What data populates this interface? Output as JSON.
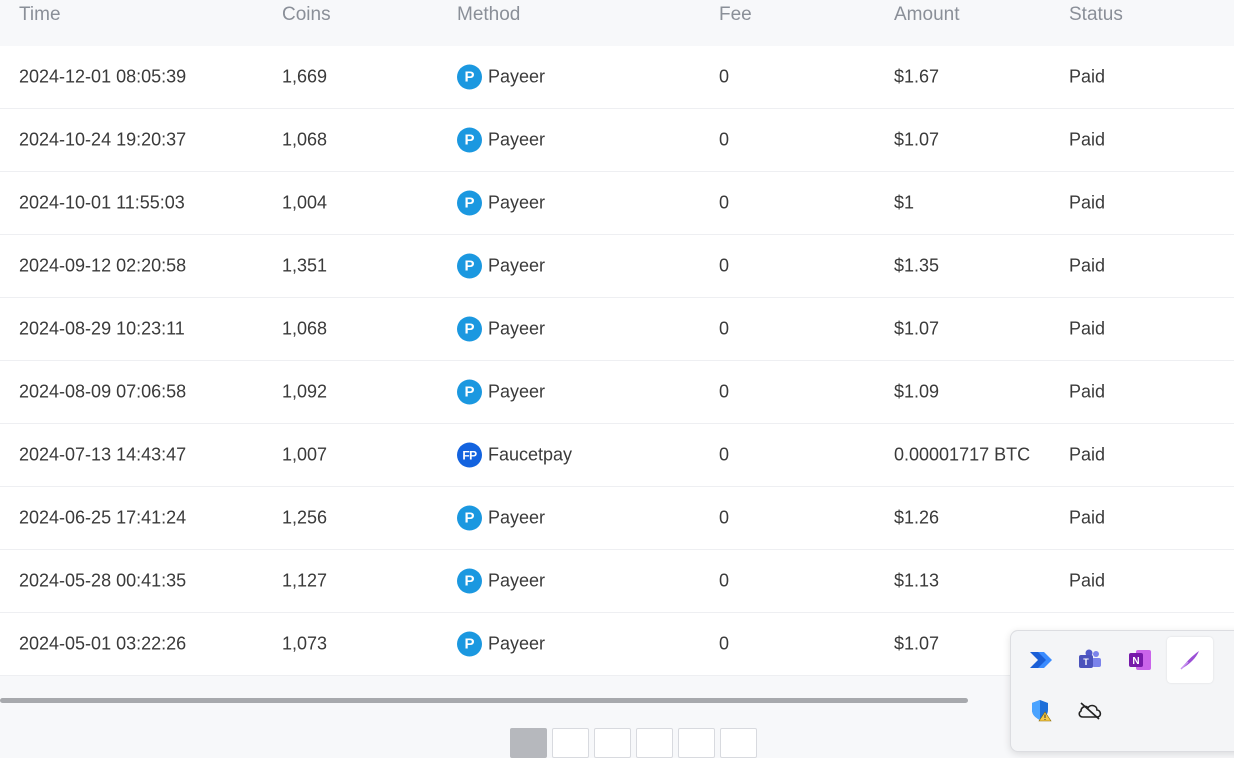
{
  "table": {
    "headers": {
      "time": "Time",
      "coins": "Coins",
      "method": "Method",
      "fee": "Fee",
      "amount": "Amount",
      "status": "Status"
    },
    "rows": [
      {
        "time": "2024-12-01 08:05:39",
        "coins": "1,669",
        "method_icon": "P",
        "method": "Payeer",
        "fee": "0",
        "amount": "$1.67",
        "status": "Paid"
      },
      {
        "time": "2024-10-24 19:20:37",
        "coins": "1,068",
        "method_icon": "P",
        "method": "Payeer",
        "fee": "0",
        "amount": "$1.07",
        "status": "Paid"
      },
      {
        "time": "2024-10-01 11:55:03",
        "coins": "1,004",
        "method_icon": "P",
        "method": "Payeer",
        "fee": "0",
        "amount": "$1",
        "status": "Paid"
      },
      {
        "time": "2024-09-12 02:20:58",
        "coins": "1,351",
        "method_icon": "P",
        "method": "Payeer",
        "fee": "0",
        "amount": "$1.35",
        "status": "Paid"
      },
      {
        "time": "2024-08-29 10:23:11",
        "coins": "1,068",
        "method_icon": "P",
        "method": "Payeer",
        "fee": "0",
        "amount": "$1.07",
        "status": "Paid"
      },
      {
        "time": "2024-08-09 07:06:58",
        "coins": "1,092",
        "method_icon": "P",
        "method": "Payeer",
        "fee": "0",
        "amount": "$1.09",
        "status": "Paid"
      },
      {
        "time": "2024-07-13 14:43:47",
        "coins": "1,007",
        "method_icon": "FP",
        "method": "Faucetpay",
        "fee": "0",
        "amount": "0.00001717 BTC",
        "status": "Paid"
      },
      {
        "time": "2024-06-25 17:41:24",
        "coins": "1,256",
        "method_icon": "P",
        "method": "Payeer",
        "fee": "0",
        "amount": "$1.26",
        "status": "Paid"
      },
      {
        "time": "2024-05-28 00:41:35",
        "coins": "1,127",
        "method_icon": "P",
        "method": "Payeer",
        "fee": "0",
        "amount": "$1.13",
        "status": "Paid"
      },
      {
        "time": "2024-05-01 03:22:26",
        "coins": "1,073",
        "method_icon": "P",
        "method": "Payeer",
        "fee": "0",
        "amount": "$1.07",
        "status": ""
      }
    ]
  },
  "icons": {
    "payeer": "payeer-icon",
    "faucetpay": "faucetpay-icon"
  },
  "colors": {
    "payeer": "#1b98e0",
    "faucetpay": "#1363df",
    "header_text": "#8a8f98",
    "body_text": "#3a3a3a"
  },
  "tray": {
    "icons": [
      "power-automate-icon",
      "teams-icon",
      "onenote-icon",
      "feather-pen-icon",
      "defender-warning-icon",
      "onedrive-offline-icon"
    ]
  }
}
